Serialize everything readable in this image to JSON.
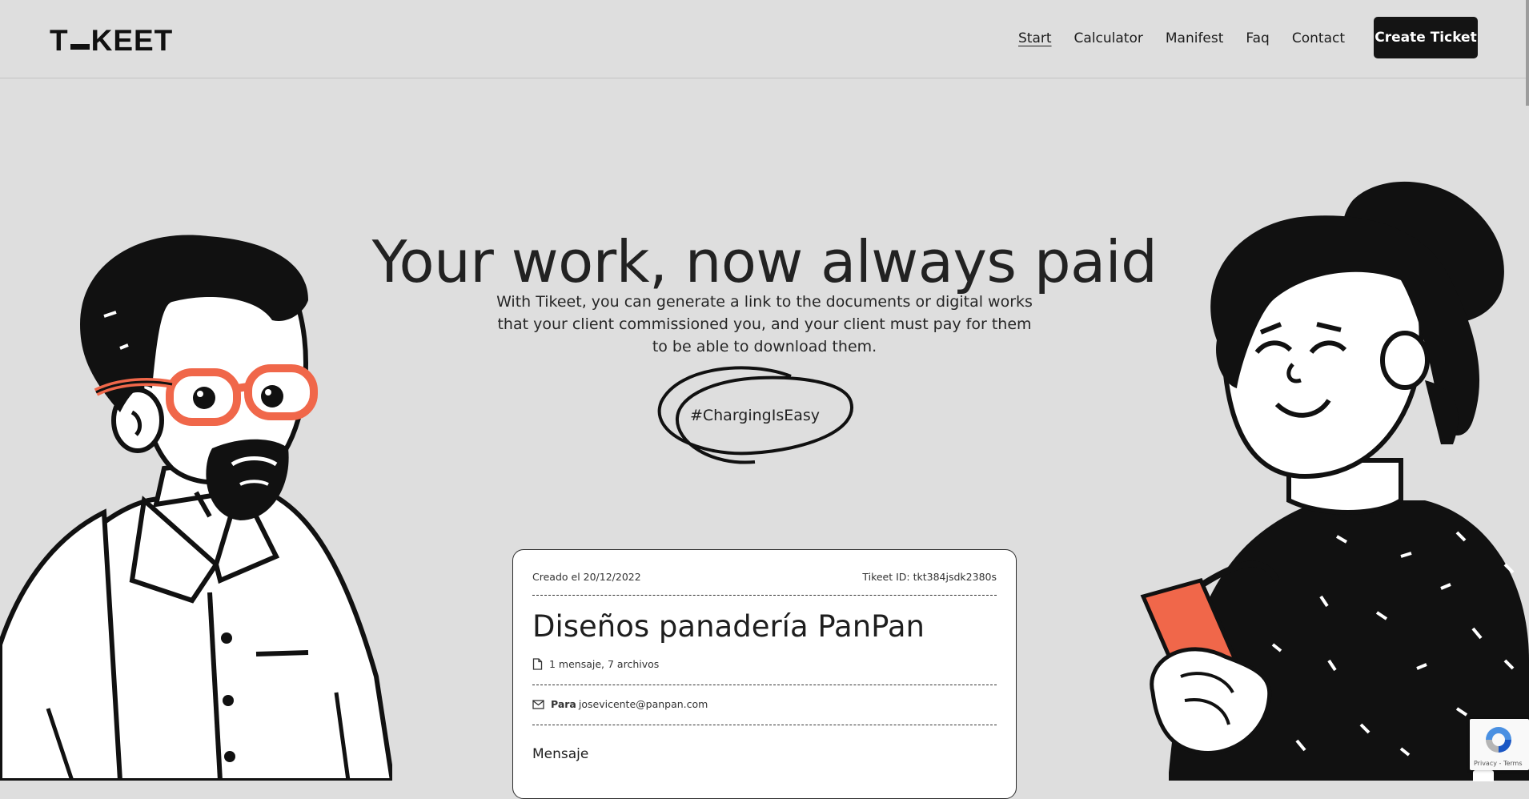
{
  "brand": {
    "logo_left": "T",
    "logo_right": "KEET"
  },
  "nav": {
    "items": [
      {
        "label": "Start",
        "active": true
      },
      {
        "label": "Calculator",
        "active": false
      },
      {
        "label": "Manifest",
        "active": false
      },
      {
        "label": "Faq",
        "active": false
      },
      {
        "label": "Contact",
        "active": false
      }
    ],
    "cta_label": "Create Ticket"
  },
  "hero": {
    "title": "Your work, now always paid",
    "subtitle": "With Tikeet, you can generate a link to the documents or digital works that your client commissioned you, and your client must pay for them to be able to download them.",
    "hashtag": "#ChargingIsEasy"
  },
  "ticket": {
    "created": "Creado el 20/12/2022",
    "tikeet_id": "Tikeet ID: tkt384jsdk2380s",
    "title": "Diseños panadería PanPan",
    "files_summary": "1 mensaje, 7 archivos",
    "to_label": "Para",
    "to_email": "josevicente@panpan.com",
    "message_heading": "Mensaje"
  },
  "recaptcha": {
    "footer": "Privacy - Terms"
  },
  "colors": {
    "background": "#dedede",
    "accent": "#f0674a",
    "dark": "#141414"
  },
  "icons": [
    "document-icon",
    "envelope-icon",
    "recaptcha-icon"
  ]
}
